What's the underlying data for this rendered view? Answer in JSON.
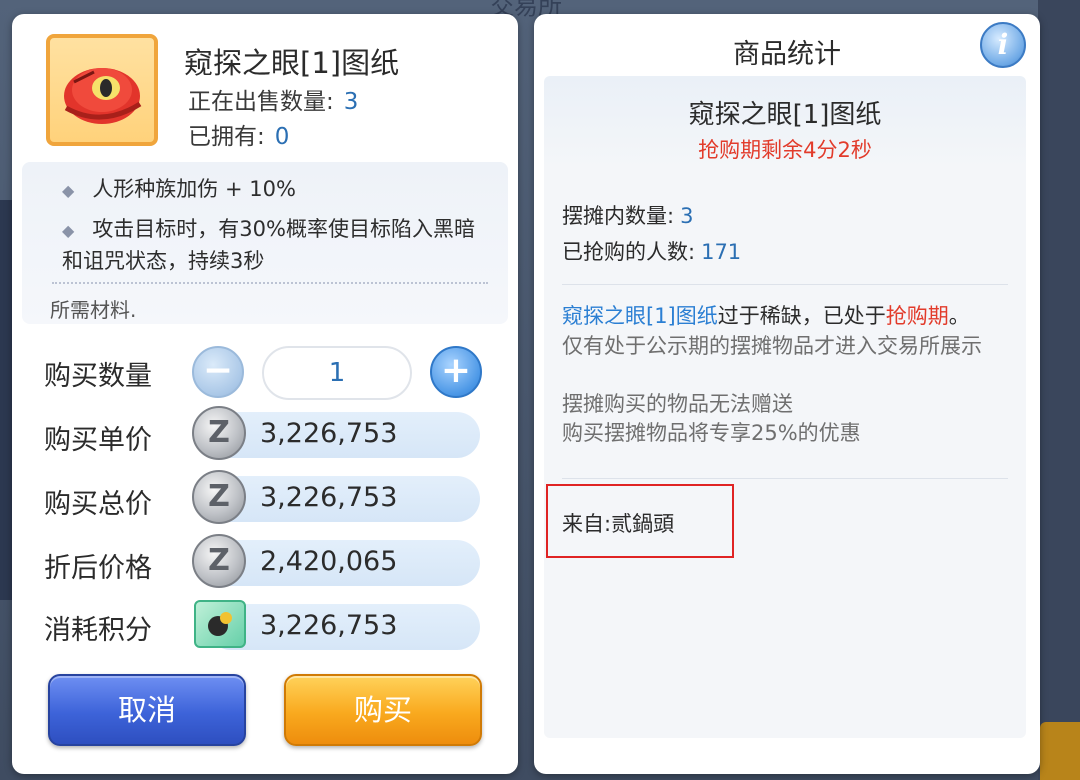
{
  "item": {
    "name": "窥探之眼[1]图纸",
    "on_sale_label": "正在出售数量:",
    "on_sale_count": "3",
    "owned_label": "已拥有:",
    "owned_count": "0",
    "effects": [
      "人形种族加伤 + 10%",
      "攻击目标时，有30%概率使目标陷入黑暗和诅咒状态，持续3秒"
    ],
    "materials_label": "所需材料."
  },
  "purchase": {
    "quantity_label": "购买数量",
    "quantity_value": "1",
    "unit_price_label": "购买单价",
    "unit_price": "3,226,753",
    "total_price_label": "购买总价",
    "total_price": "3,226,753",
    "discount_price_label": "折后价格",
    "discount_price": "2,420,065",
    "points_label": "消耗积分",
    "points": "3,226,753",
    "cancel_label": "取消",
    "buy_label": "购买"
  },
  "stats": {
    "title": "商品统计",
    "info_icon_glyph": "i",
    "item_name": "窥探之眼[1]图纸",
    "countdown": "抢购期剩余4分2秒",
    "stall_count_label": "摆摊内数量:",
    "stall_count": "3",
    "buyers_label": "已抢购的人数:",
    "buyers": "171",
    "notice_item": "窥探之眼[1]图纸",
    "notice_mid": "过于稀缺，已处于",
    "notice_red": "抢购期",
    "notice_end": "。",
    "notes": [
      "仅有处于公示期的摆摊物品才进入交易所展示",
      "摆摊购买的物品无法赠送",
      "购买摆摊物品将专享25%的优惠"
    ],
    "from_label": "来自:",
    "from_value": "贰鍋頭"
  },
  "background": {
    "top_text": "交易所"
  },
  "colors": {
    "accent_blue": "#2b6fb3",
    "alert_red": "#e23b2b",
    "cancel_button": "#3d63d9",
    "buy_button": "#f9a91e",
    "highlight_box": "#e02424"
  }
}
